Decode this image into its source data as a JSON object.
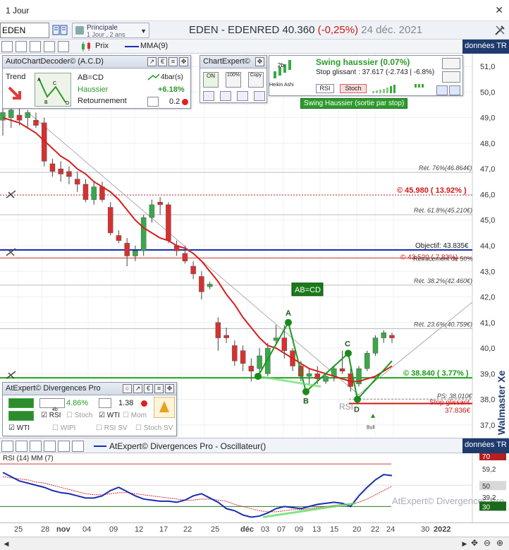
{
  "window": {
    "title": "1 Jour",
    "close": "✕"
  },
  "toolbar": {
    "symbol": "EDEN",
    "period_title": "Principale",
    "period_sub": "1 Jour , 2 ans",
    "stock_name": "EDEN - EDENRED",
    "price": "40.360",
    "change": "(-0,25%)",
    "date": "24 déc. 2021"
  },
  "chart_toolbar": {
    "prix_label": "Prix",
    "mma_label": "MMA(9)",
    "donnees": "données TR"
  },
  "acd_panel": {
    "title": "AutoChartDecoder© (A.C.D)",
    "trend": "Trend",
    "pattern": "AB=CD",
    "direction": "Haussier",
    "kind": "Retournement",
    "bars": "4bar(s)",
    "pct": "+6.18%",
    "val": "0.2"
  },
  "chartexpert_panel": {
    "title": "ChartExpert©",
    "on_label": "ON",
    "pct100": "100%",
    "copy": "Copy",
    "heikin": "Heikin Ashi",
    "swing_title": "Swing haussier (0.07%)",
    "stop_line": "Stop glissant : 37.617  (-2.743 | -6.8%)",
    "rsi_btn": "RSI",
    "stoch_btn": "Stoch",
    "swing_badge": "Swing Haussier (sortie par stop)"
  },
  "divergences_panel": {
    "title": "AtExpert© Divergences Pro",
    "pct": "4.86%",
    "bars": "4b",
    "ratio": "1.38",
    "rsi": "RSI",
    "stoch": "Stoch",
    "wti": "WTI",
    "mom": "Mom",
    "wti2": "WTI",
    "wipi": "WIPI",
    "rsisv": "RSI SV",
    "stochsv": "Stoch SV"
  },
  "chart_labels": {
    "ret76": "Rét. 76%(46.864€)",
    "level_4598": "© 45.980 ( 13.92% )",
    "ret618": "Rét. 61.8%(45.210€)",
    "objectif": "Objectif: 43.835€",
    "ret50_a": "© 43.520 ( 7.83%)",
    "ret50_b": "Retracement de 50%",
    "ret382": "Rét. 38.2%(42.460€)",
    "abcd": "AB=CD",
    "ret236": "Rét. 23.6%(40.759€)",
    "level_3884": "© 38.840 ( 3.77% )",
    "ps": "PS: 38.010€",
    "stop_glissant": "Stop glissant",
    "stop_val": "37.836€",
    "rsi_tag": "RSI",
    "bull": "Bull",
    "pt_a": "A",
    "pt_b": "B",
    "pt_c": "C",
    "pt_d": "D",
    "watermark": "Walmaster Xe"
  },
  "y_axis": [
    "51,0",
    "50,0",
    "49,0",
    "48,0",
    "47,0",
    "46,0",
    "45,0",
    "44,0",
    "43,0",
    "42,0",
    "41,0",
    "40,0",
    "39,0",
    "38,0",
    "37,0"
  ],
  "oscillator": {
    "header": "AtExpert© Divergences Pro - Oscillateur()",
    "donnees": "données TR",
    "label": "RSI (14) MM (7)",
    "lv70": "70",
    "lv592": "59,2",
    "lv50": "50",
    "lv392": "39,2",
    "lv30": "30",
    "watermark": "AtExpert© Divergences Pro"
  },
  "x_axis": [
    "25",
    "28",
    "nov",
    "04",
    "09",
    "12",
    "17",
    "22",
    "25",
    "déc",
    "03",
    "07",
    "09",
    "13",
    "15",
    "20",
    "22",
    "24",
    "30",
    "2022"
  ],
  "colors": {
    "up": "#3aa84a",
    "down": "#d83030",
    "mma": "#d81c1c",
    "brand": "#1f3b6e",
    "blue_line": "#1a2db0",
    "green_line": "#1aa81a"
  },
  "chart_data": {
    "type": "candlestick",
    "ylim": [
      36.5,
      51.5
    ],
    "candles": [
      {
        "o": 48.9,
        "h": 49.5,
        "l": 48.3,
        "c": 49.2
      },
      {
        "o": 49.0,
        "h": 49.6,
        "l": 48.6,
        "c": 49.3
      },
      {
        "o": 49.1,
        "h": 49.5,
        "l": 48.7,
        "c": 48.9
      },
      {
        "o": 49.0,
        "h": 49.3,
        "l": 48.6,
        "c": 49.2
      },
      {
        "o": 48.9,
        "h": 49.2,
        "l": 48.6,
        "c": 48.7
      },
      {
        "o": 48.8,
        "h": 49.0,
        "l": 47.1,
        "c": 47.3
      },
      {
        "o": 47.2,
        "h": 47.4,
        "l": 46.7,
        "c": 46.9
      },
      {
        "o": 47.0,
        "h": 47.3,
        "l": 46.5,
        "c": 46.8
      },
      {
        "o": 46.9,
        "h": 47.1,
        "l": 46.4,
        "c": 46.7
      },
      {
        "o": 46.6,
        "h": 46.9,
        "l": 46.1,
        "c": 46.4
      },
      {
        "o": 46.4,
        "h": 46.6,
        "l": 45.7,
        "c": 45.8
      },
      {
        "o": 45.8,
        "h": 46.5,
        "l": 45.6,
        "c": 46.3
      },
      {
        "o": 46.3,
        "h": 46.5,
        "l": 45.7,
        "c": 45.8
      },
      {
        "o": 45.5,
        "h": 45.7,
        "l": 44.4,
        "c": 44.5
      },
      {
        "o": 44.4,
        "h": 44.6,
        "l": 44.1,
        "c": 44.2
      },
      {
        "o": 44.1,
        "h": 44.3,
        "l": 43.2,
        "c": 43.6
      },
      {
        "o": 43.6,
        "h": 44.0,
        "l": 43.4,
        "c": 43.8
      },
      {
        "o": 43.8,
        "h": 45.2,
        "l": 43.6,
        "c": 45.1
      },
      {
        "o": 45.1,
        "h": 45.8,
        "l": 44.9,
        "c": 45.6
      },
      {
        "o": 45.7,
        "h": 45.9,
        "l": 45.2,
        "c": 45.6
      },
      {
        "o": 45.6,
        "h": 45.7,
        "l": 44.1,
        "c": 44.2
      },
      {
        "o": 44.0,
        "h": 44.2,
        "l": 43.6,
        "c": 43.8
      },
      {
        "o": 43.7,
        "h": 44.0,
        "l": 43.3,
        "c": 43.4
      },
      {
        "o": 43.2,
        "h": 43.4,
        "l": 42.7,
        "c": 42.9
      },
      {
        "o": 42.8,
        "h": 43.0,
        "l": 41.9,
        "c": 42.2
      },
      {
        "o": 42.4,
        "h": 42.6,
        "l": 42.3,
        "c": 42.5
      },
      {
        "o": 41.0,
        "h": 41.2,
        "l": 39.9,
        "c": 40.4
      },
      {
        "o": 40.5,
        "h": 40.8,
        "l": 40.2,
        "c": 40.4
      },
      {
        "o": 40.1,
        "h": 40.3,
        "l": 39.3,
        "c": 39.5
      },
      {
        "o": 39.9,
        "h": 40.1,
        "l": 39.1,
        "c": 39.4
      },
      {
        "o": 39.3,
        "h": 39.6,
        "l": 38.7,
        "c": 39.1
      },
      {
        "o": 39.2,
        "h": 40.0,
        "l": 38.9,
        "c": 39.7
      },
      {
        "o": 39.0,
        "h": 40.2,
        "l": 38.9,
        "c": 40.0
      },
      {
        "o": 40.3,
        "h": 40.9,
        "l": 40.2,
        "c": 40.4
      },
      {
        "o": 40.4,
        "h": 40.9,
        "l": 39.6,
        "c": 39.9
      },
      {
        "o": 39.9,
        "h": 40.0,
        "l": 39.1,
        "c": 39.3
      },
      {
        "o": 39.3,
        "h": 39.5,
        "l": 38.7,
        "c": 38.9
      },
      {
        "o": 38.9,
        "h": 39.2,
        "l": 38.6,
        "c": 39.0
      },
      {
        "o": 39.0,
        "h": 39.3,
        "l": 38.6,
        "c": 38.8
      },
      {
        "o": 38.7,
        "h": 39.0,
        "l": 38.6,
        "c": 38.9
      },
      {
        "o": 38.9,
        "h": 39.3,
        "l": 38.7,
        "c": 39.2
      },
      {
        "o": 39.2,
        "h": 39.9,
        "l": 39.0,
        "c": 39.1
      },
      {
        "o": 39.0,
        "h": 39.2,
        "l": 38.3,
        "c": 38.5
      },
      {
        "o": 38.6,
        "h": 39.3,
        "l": 38.5,
        "c": 39.2
      },
      {
        "o": 39.2,
        "h": 39.9,
        "l": 39.1,
        "c": 39.8
      },
      {
        "o": 39.8,
        "h": 40.5,
        "l": 39.7,
        "c": 40.4
      },
      {
        "o": 40.4,
        "h": 40.7,
        "l": 40.2,
        "c": 40.6
      },
      {
        "o": 40.5,
        "h": 40.6,
        "l": 40.2,
        "c": 40.4
      }
    ],
    "mma9": [
      49.0,
      48.9,
      48.8,
      48.6,
      48.4,
      48.1,
      47.8,
      47.5,
      47.3,
      47.0,
      46.8,
      46.5,
      46.3,
      46.1,
      45.8,
      45.4,
      45.0,
      44.7,
      44.5,
      44.3,
      44.2,
      44.0,
      43.9,
      43.7,
      43.4,
      43.0,
      42.6,
      42.1,
      41.7,
      41.2,
      40.8,
      40.4,
      40.1,
      40.0,
      39.8,
      39.6,
      39.4,
      39.2,
      39.1,
      39.0,
      38.9,
      38.8,
      38.7,
      38.7,
      38.8,
      38.9,
      39.1,
      39.3
    ],
    "levels": [
      {
        "name": "ret76",
        "value": 46.864
      },
      {
        "name": "level_4598",
        "value": 45.98
      },
      {
        "name": "ret618",
        "value": 45.21
      },
      {
        "name": "objectif",
        "value": 43.835
      },
      {
        "name": "ret50",
        "value": 43.52
      },
      {
        "name": "ret382",
        "value": 42.46
      },
      {
        "name": "ret236",
        "value": 40.759
      },
      {
        "name": "level_3884",
        "value": 38.84
      },
      {
        "name": "ps",
        "value": 38.01
      },
      {
        "name": "stop",
        "value": 37.836
      }
    ],
    "abcd": {
      "A": 41.0,
      "B": 38.3,
      "C": 39.8,
      "D": 38.0
    },
    "rsi": [
      62,
      58,
      54,
      52,
      50,
      48,
      45,
      43,
      42,
      40,
      38,
      38,
      40,
      45,
      48,
      44,
      40,
      37,
      36,
      35,
      35,
      34,
      36,
      40,
      42,
      38,
      34,
      28,
      26,
      22,
      20,
      21,
      24,
      28,
      30,
      29,
      28,
      30,
      32,
      33,
      34,
      33,
      30,
      40,
      48,
      55,
      60,
      59
    ],
    "rsi_ma": [
      58,
      57,
      56,
      55,
      53,
      52,
      50,
      48,
      46,
      44,
      42,
      41,
      41,
      42,
      43,
      43,
      42,
      41,
      40,
      39,
      38,
      37,
      36,
      36,
      37,
      37,
      36,
      35,
      32,
      30,
      28,
      26,
      25,
      25,
      26,
      27,
      27,
      28,
      29,
      30,
      31,
      32,
      32,
      34,
      37,
      41,
      45,
      49
    ],
    "rsi_ylim": [
      15,
      80
    ]
  }
}
